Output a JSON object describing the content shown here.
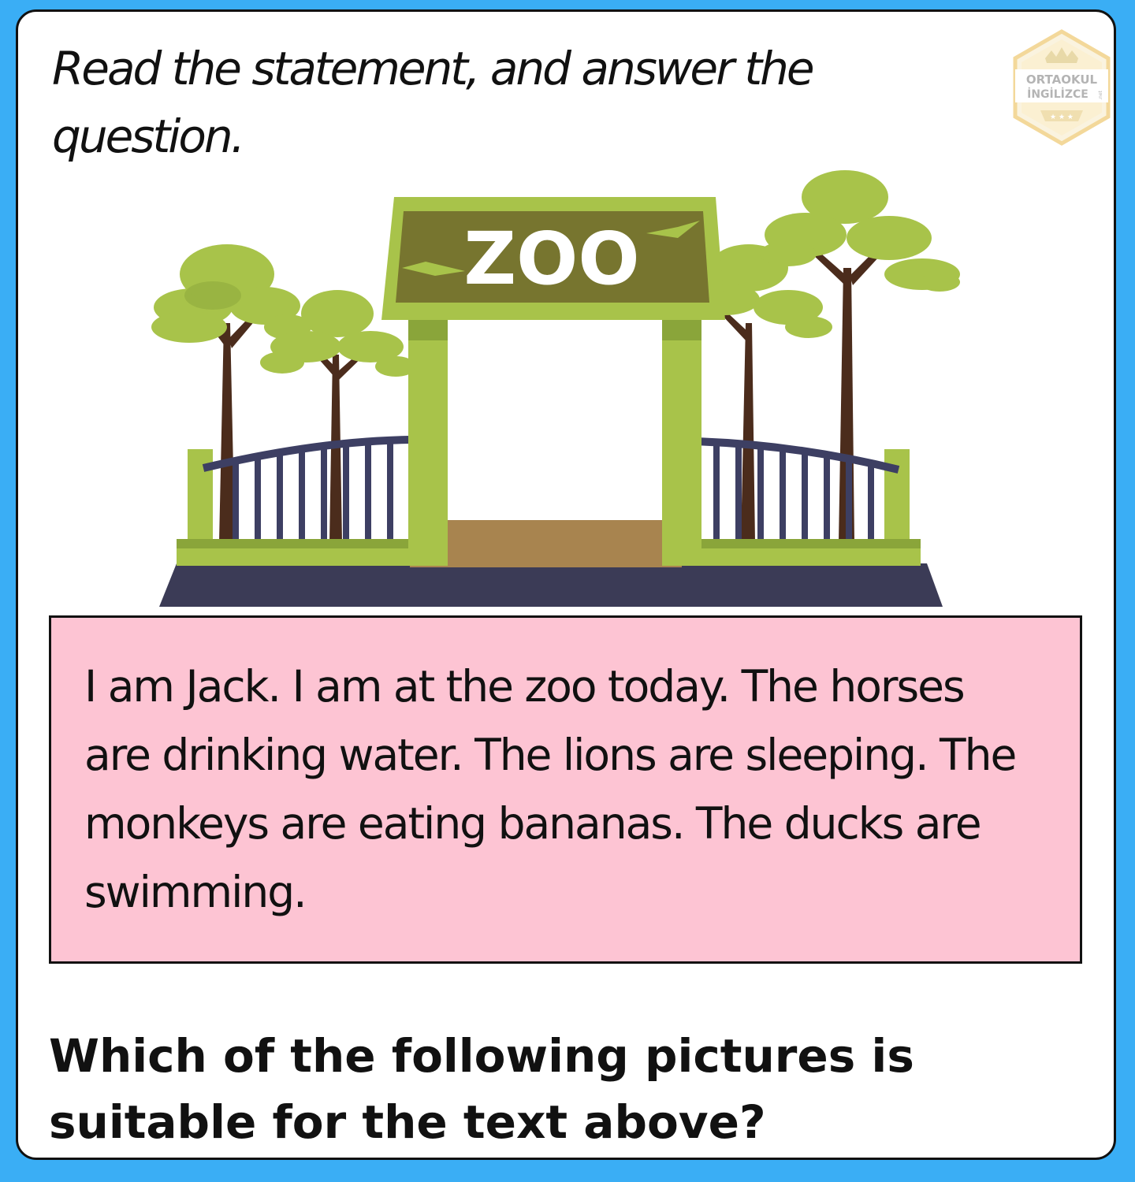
{
  "instruction": "Read the statement, and answer the question.",
  "logo": {
    "line1": "ORTAOKUL",
    "line2": "İNGİLİZCE",
    "suffix": ".net",
    "colors": {
      "badge": "#f3d89a",
      "text": "#b0b0b0"
    }
  },
  "illustration": {
    "sign_text": "ZOO",
    "colors": {
      "gate": "#a8c34a",
      "gate_shadow": "#8aa53a",
      "sign_panel": "#77752f",
      "path": "#a8844f",
      "ground": "#3b3b56",
      "fence": "#3d3f63",
      "tree_canopy": "#a8c34a",
      "tree_trunk": "#4b2c1c"
    }
  },
  "statement": "I am Jack. I am at the zoo today. The horses are drinking water. The lions are sleeping. The monkeys are eating bananas. The ducks are swimming.",
  "question": "Which of the following pictures is suitable for the text above?",
  "colors": {
    "background": "#3aaef5",
    "card": "#ffffff",
    "statement_box": "#fdc4d3"
  }
}
